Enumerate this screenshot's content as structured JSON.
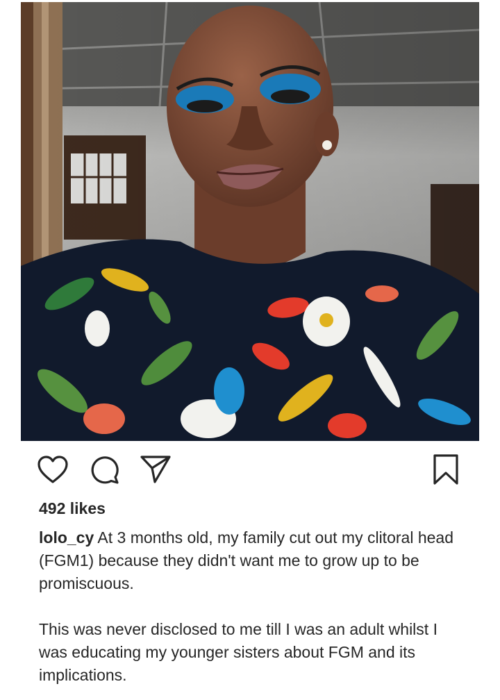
{
  "post": {
    "image_alt": "Selfie of a woman with a shaved head, blue eyeshadow and a dark floral top",
    "likes_text": "492 likes",
    "username": "lolo_cy",
    "caption_first": "At 3 months old, my family cut out my clitoral head (FGM1) because they didn't want me to grow up to be promiscuous.",
    "caption_second": "This was never disclosed to me till I was an adult whilst I was educating my younger sisters about FGM and its implications."
  },
  "actions": {
    "like_icon": "heart-icon",
    "comment_icon": "comment-bubble-icon",
    "share_icon": "paper-plane-icon",
    "save_icon": "bookmark-icon"
  },
  "colors": {
    "text": "#262626",
    "icon": "#262626",
    "background": "#ffffff"
  }
}
